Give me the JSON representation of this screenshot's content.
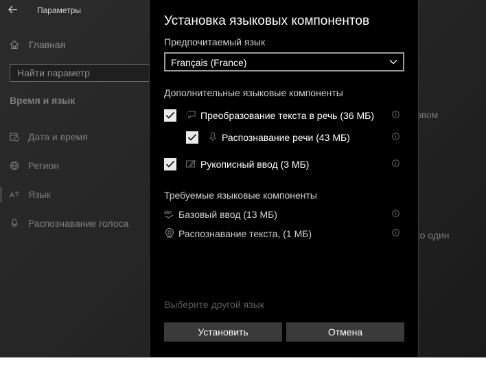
{
  "window": {
    "app_title": "Параметры",
    "nav_home": "Главная",
    "search_placeholder": "Найти параметр",
    "section_title": "Время и язык",
    "nav_items": [
      "Дата и время",
      "Регион",
      "Язык",
      "Распознавание голоса"
    ],
    "peek_text_1": "ервом",
    "peek_text_2": "ько один"
  },
  "dialog": {
    "title": "Установка языковых компонентов",
    "preferred_language_label": "Предпочитаемый язык",
    "selected_language": "Français (France)",
    "optional_label": "Дополнительные языковые компоненты",
    "optional_features": [
      {
        "label": "Преобразование текста в речь (36 МБ)",
        "checked": true,
        "icon": "speech-bubble-icon"
      },
      {
        "label": "Распознавание речи (43 МБ)",
        "checked": true,
        "icon": "microphone-icon"
      },
      {
        "label": "Рукописный ввод (3 МБ)",
        "checked": true,
        "icon": "pen-icon"
      }
    ],
    "required_label": "Требуемые языковые компоненты",
    "required_features": [
      {
        "label": "Базовый ввод (13 МБ)",
        "icon": "abc-icon"
      },
      {
        "label": "Распознавание текста, (1 МБ)",
        "icon": "webcam-icon"
      }
    ],
    "choose_other_language": "Выберите другой язык",
    "install_button": "Установить",
    "cancel_button": "Отмена"
  },
  "colors": {
    "dialog_bg": "#000000",
    "button_bg": "#3a3a3a",
    "checkbox_bg": "#eaeaea"
  }
}
